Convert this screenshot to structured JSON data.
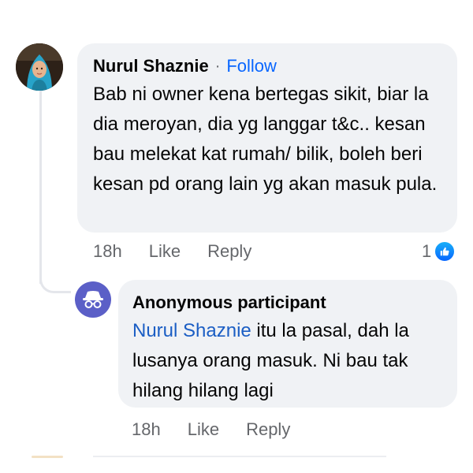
{
  "main_comment": {
    "author": "Nurul Shaznie",
    "separator": "·",
    "follow_label": "Follow",
    "text": "Bab ni owner kena bertegas sikit, biar la dia meroyan, dia yg langgar t&c.. kesan bau melekat kat rumah/ bilik, boleh beri kesan pd orang lain yg akan masuk pula.",
    "time": "18h",
    "like_label": "Like",
    "reply_label": "Reply",
    "reaction_count": "1",
    "reaction_icon": "thumbs-up-icon"
  },
  "reply_comment": {
    "author": "Anonymous participant",
    "mention": "Nurul Shaznie",
    "text": " itu la pasal, dah la lusanya orang masuk. Ni bau tak hilang hilang lagi",
    "time": "18h",
    "like_label": "Like",
    "reply_label": "Reply",
    "avatar_icon": "incognito-icon"
  },
  "colors": {
    "bubble_bg": "#f0f2f5",
    "link_blue": "#0866ff",
    "mention_blue": "#1b5ec4",
    "meta_gray": "#65676b",
    "anon_avatar_bg": "#5b5fc7"
  }
}
